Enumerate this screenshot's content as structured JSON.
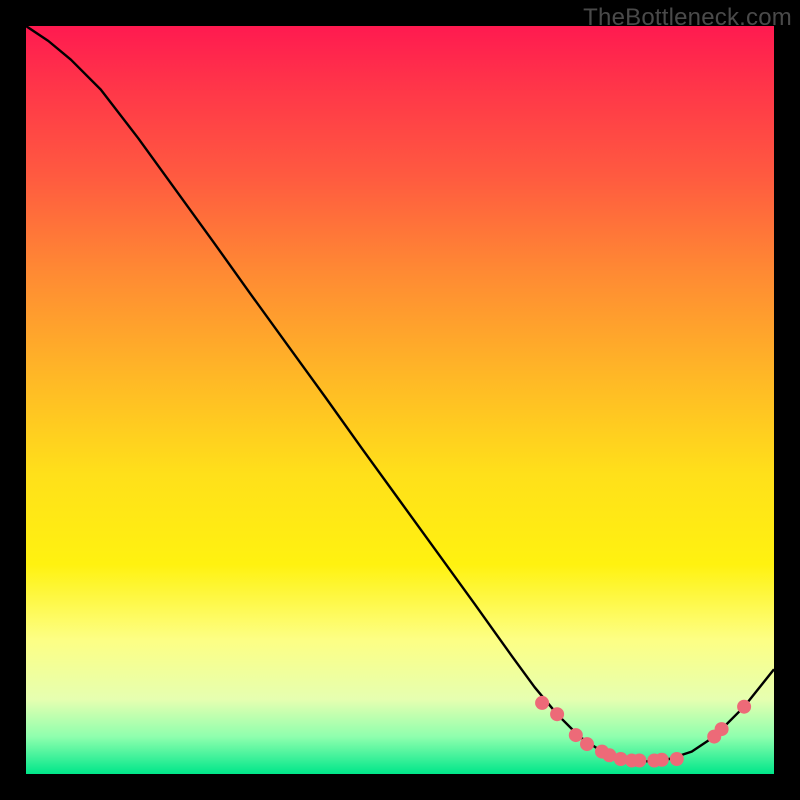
{
  "watermark": "TheBottleneck.com",
  "chart_data": {
    "type": "line",
    "title": "",
    "xlabel": "",
    "ylabel": "",
    "xlim": [
      0,
      100
    ],
    "ylim": [
      0,
      100
    ],
    "grid": false,
    "curve": [
      {
        "x": 0,
        "y": 100
      },
      {
        "x": 3,
        "y": 98
      },
      {
        "x": 6,
        "y": 95.5
      },
      {
        "x": 10,
        "y": 91.5
      },
      {
        "x": 15,
        "y": 85
      },
      {
        "x": 20,
        "y": 78.1
      },
      {
        "x": 25,
        "y": 71.2
      },
      {
        "x": 30,
        "y": 64.2
      },
      {
        "x": 35,
        "y": 57.3
      },
      {
        "x": 40,
        "y": 50.4
      },
      {
        "x": 45,
        "y": 43.4
      },
      {
        "x": 50,
        "y": 36.5
      },
      {
        "x": 55,
        "y": 29.6
      },
      {
        "x": 60,
        "y": 22.7
      },
      {
        "x": 65,
        "y": 15.7
      },
      {
        "x": 68,
        "y": 11.6
      },
      {
        "x": 71,
        "y": 8
      },
      {
        "x": 74,
        "y": 5
      },
      {
        "x": 77,
        "y": 3
      },
      {
        "x": 80,
        "y": 2
      },
      {
        "x": 83,
        "y": 1.7
      },
      {
        "x": 86,
        "y": 2
      },
      {
        "x": 89,
        "y": 3
      },
      {
        "x": 92,
        "y": 5
      },
      {
        "x": 96,
        "y": 9
      },
      {
        "x": 100,
        "y": 14
      }
    ],
    "points": [
      {
        "x": 69,
        "y": 9.5
      },
      {
        "x": 71,
        "y": 8
      },
      {
        "x": 73.5,
        "y": 5.2
      },
      {
        "x": 75,
        "y": 4
      },
      {
        "x": 77,
        "y": 3
      },
      {
        "x": 78,
        "y": 2.5
      },
      {
        "x": 79.5,
        "y": 2
      },
      {
        "x": 81,
        "y": 1.8
      },
      {
        "x": 82,
        "y": 1.8
      },
      {
        "x": 84,
        "y": 1.8
      },
      {
        "x": 85,
        "y": 1.9
      },
      {
        "x": 87,
        "y": 2
      },
      {
        "x": 92,
        "y": 5
      },
      {
        "x": 93,
        "y": 6
      },
      {
        "x": 96,
        "y": 9
      }
    ],
    "point_color": "#ed6a78",
    "curve_color": "#000000"
  }
}
